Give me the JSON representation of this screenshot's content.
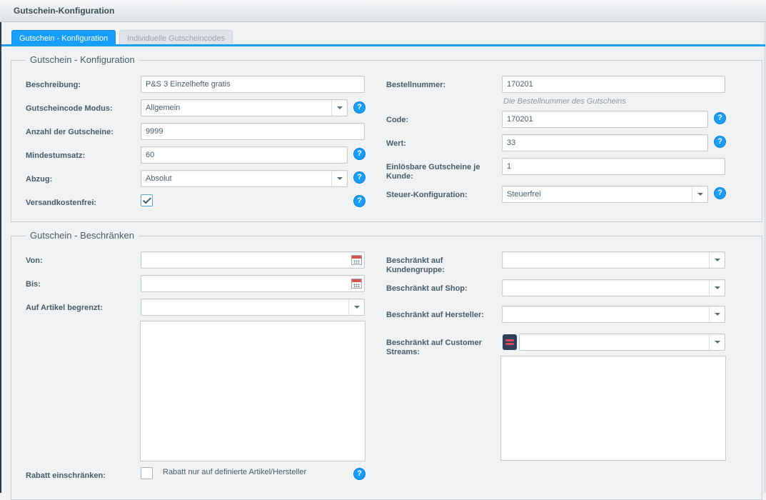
{
  "window": {
    "title": "Gutschein-Konfiguration"
  },
  "tabs": [
    {
      "label": "Gutschein - Konfiguration",
      "active": true
    },
    {
      "label": "Individuelle Gutscheincodes",
      "active": false
    }
  ],
  "config": {
    "legend": "Gutschein - Konfiguration",
    "beschreibung": {
      "label": "Beschreibung:",
      "value": "P&S 3 Einzelhefte gratis"
    },
    "modus": {
      "label": "Gutscheincode Modus:",
      "value": "Allgemein"
    },
    "anzahl": {
      "label": "Anzahl der Gutscheine:",
      "value": "9999"
    },
    "mindestumsatz": {
      "label": "Mindestumsatz:",
      "value": "60"
    },
    "abzug": {
      "label": "Abzug:",
      "value": "Absolut"
    },
    "versandkostenfrei": {
      "label": "Versandkostenfrei:",
      "checked": true
    },
    "bestellnummer": {
      "label": "Bestellnummer:",
      "value": "170201",
      "hint": "Die Bestellnummer des Gutscheins"
    },
    "code": {
      "label": "Code:",
      "value": "170201"
    },
    "wert": {
      "label": "Wert:",
      "value": "33"
    },
    "einloesbar": {
      "label": "Einlösbare Gutscheine je Kunde:",
      "value": "1"
    },
    "steuer": {
      "label": "Steuer-Konfiguration:",
      "value": "Steuerfrei"
    }
  },
  "restrict": {
    "legend": "Gutschein - Beschränken",
    "von": {
      "label": "Von:",
      "value": ""
    },
    "bis": {
      "label": "Bis:",
      "value": ""
    },
    "artikel": {
      "label": "Auf Artikel begrenzt:",
      "value": ""
    },
    "kundengruppe": {
      "label": "Beschränkt auf Kundengruppe:",
      "value": ""
    },
    "shop": {
      "label": "Beschränkt auf Shop:",
      "value": ""
    },
    "hersteller": {
      "label": "Beschränkt auf Hersteller:",
      "value": ""
    },
    "streams": {
      "label": "Beschränkt auf Customer Streams:",
      "value": ""
    },
    "rabatt": {
      "label": "Rabatt einschränken:",
      "checkbox_text": "Rabatt nur auf definierte Artikel/Hersteller",
      "checked": false
    }
  },
  "help_symbol": "?",
  "colors": {
    "accent": "#189eff",
    "text": "#475c6a",
    "background": "#f0f2f4"
  }
}
